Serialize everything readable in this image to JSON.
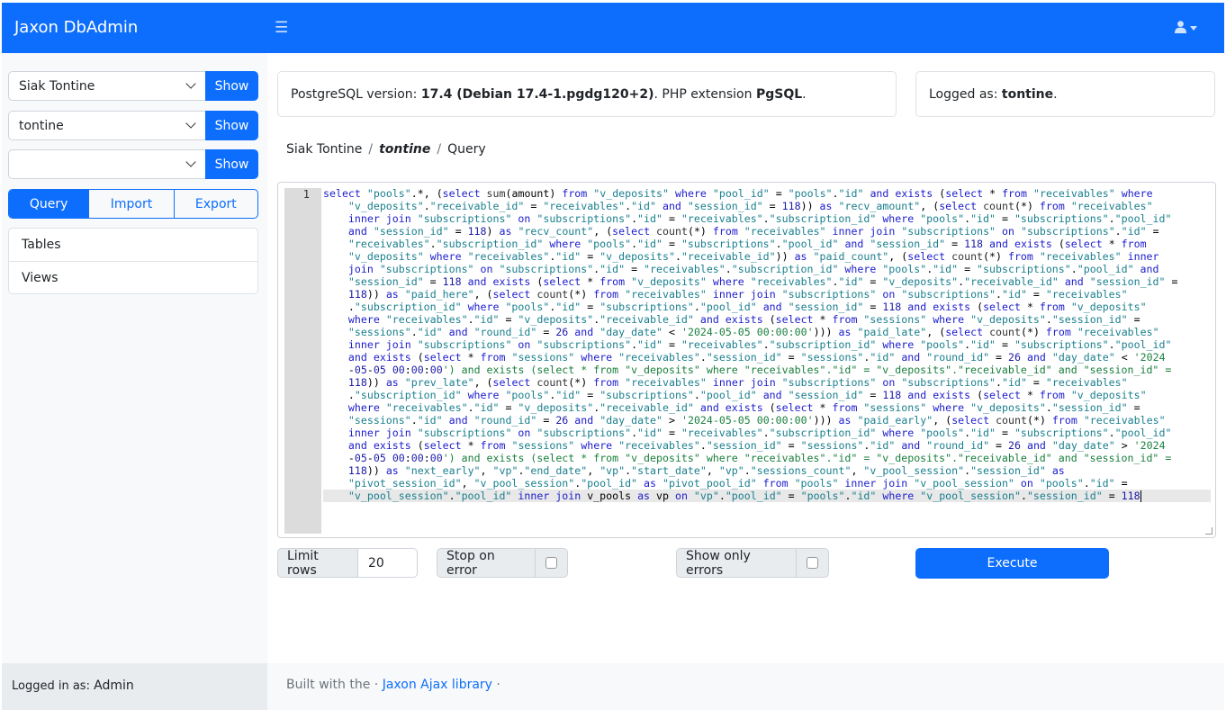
{
  "app": {
    "title": "Jaxon DbAdmin",
    "menu_icon": "hamburger-icon",
    "user_icon": "user-icon"
  },
  "sidebar": {
    "selects": [
      {
        "value": "Siak Tontine",
        "button": "Show"
      },
      {
        "value": "tontine",
        "button": "Show"
      },
      {
        "value": "",
        "button": "Show"
      }
    ],
    "tabs": [
      "Query",
      "Import",
      "Export"
    ],
    "active_tab": "Query",
    "items": [
      "Tables",
      "Views"
    ],
    "footer_label": "Logged in as:",
    "footer_user": "Admin"
  },
  "info": {
    "version_prefix": "PostgreSQL version: ",
    "version": "17.4 (Debian 17.4-1.pgdg120+2)",
    "ext_prefix": ". PHP extension ",
    "ext": "PgSQL",
    "ext_suffix": ".",
    "logged_prefix": "Logged as: ",
    "logged_user": "tontine",
    "logged_suffix": "."
  },
  "breadcrumb": {
    "server": "Siak Tontine",
    "sep": "/",
    "db": "tontine",
    "page": "Query"
  },
  "editor": {
    "line_number": "1",
    "lines": [
      "select \"pools\".*, (select sum(amount) from \"v_deposits\" where \"pool_id\" = \"pools\".\"id\" and exists (select * from \"receivables\" where",
      "    \"v_deposits\".\"receivable_id\" = \"receivables\".\"id\" and \"session_id\" = 118)) as \"recv_amount\", (select count(*) from \"receivables\"",
      "    inner join \"subscriptions\" on \"subscriptions\".\"id\" = \"receivables\".\"subscription_id\" where \"pools\".\"id\" = \"subscriptions\".\"pool_id\"",
      "    and \"session_id\" = 118) as \"recv_count\", (select count(*) from \"receivables\" inner join \"subscriptions\" on \"subscriptions\".\"id\" =",
      "    \"receivables\".\"subscription_id\" where \"pools\".\"id\" = \"subscriptions\".\"pool_id\" and \"session_id\" = 118 and exists (select * from",
      "    \"v_deposits\" where \"receivables\".\"id\" = \"v_deposits\".\"receivable_id\")) as \"paid_count\", (select count(*) from \"receivables\" inner",
      "    join \"subscriptions\" on \"subscriptions\".\"id\" = \"receivables\".\"subscription_id\" where \"pools\".\"id\" = \"subscriptions\".\"pool_id\" and",
      "    \"session_id\" = 118 and exists (select * from \"v_deposits\" where \"receivables\".\"id\" = \"v_deposits\".\"receivable_id\" and \"session_id\" =",
      "    118)) as \"paid_here\", (select count(*) from \"receivables\" inner join \"subscriptions\" on \"subscriptions\".\"id\" = \"receivables\"",
      "    .\"subscription_id\" where \"pools\".\"id\" = \"subscriptions\".\"pool_id\" and \"session_id\" = 118 and exists (select * from \"v_deposits\"",
      "    where \"receivables\".\"id\" = \"v_deposits\".\"receivable_id\" and exists (select * from \"sessions\" where \"v_deposits\".\"session_id\" =",
      "    \"sessions\".\"id\" and \"round_id\" = 26 and \"day_date\" < '2024-05-05 00:00:00'))) as \"paid_late\", (select count(*) from \"receivables\"",
      "    inner join \"subscriptions\" on \"subscriptions\".\"id\" = \"receivables\".\"subscription_id\" where \"pools\".\"id\" = \"subscriptions\".\"pool_id\"",
      "    and exists (select * from \"sessions\" where \"receivables\".\"session_id\" = \"sessions\".\"id\" and \"round_id\" = 26 and \"day_date\" < '2024",
      "    -05-05 00:00:00') and exists (select * from \"v_deposits\" where \"receivables\".\"id\" = \"v_deposits\".\"receivable_id\" and \"session_id\" =",
      "    118)) as \"prev_late\", (select count(*) from \"receivables\" inner join \"subscriptions\" on \"subscriptions\".\"id\" = \"receivables\"",
      "    .\"subscription_id\" where \"pools\".\"id\" = \"subscriptions\".\"pool_id\" and \"session_id\" = 118 and exists (select * from \"v_deposits\"",
      "    where \"receivables\".\"id\" = \"v_deposits\".\"receivable_id\" and exists (select * from \"sessions\" where \"v_deposits\".\"session_id\" =",
      "    \"sessions\".\"id\" and \"round_id\" = 26 and \"day_date\" > '2024-05-05 00:00:00'))) as \"paid_early\", (select count(*) from \"receivables\"",
      "    inner join \"subscriptions\" on \"subscriptions\".\"id\" = \"receivables\".\"subscription_id\" where \"pools\".\"id\" = \"subscriptions\".\"pool_id\"",
      "    and exists (select * from \"sessions\" where \"receivables\".\"session_id\" = \"sessions\".\"id\" and \"round_id\" = 26 and \"day_date\" > '2024",
      "    -05-05 00:00:00') and exists (select * from \"v_deposits\" where \"receivables\".\"id\" = \"v_deposits\".\"receivable_id\" and \"session_id\" =",
      "    118)) as \"next_early\", \"vp\".\"end_date\", \"vp\".\"start_date\", \"vp\".\"sessions_count\", \"v_pool_session\".\"session_id\" as",
      "    \"pivot_session_id\", \"v_pool_session\".\"pool_id\" as \"pivot_pool_id\" from \"pools\" inner join \"v_pool_session\" on \"pools\".\"id\" =",
      "    \"v_pool_session\".\"pool_id\" inner join v_pools as vp on \"vp\".\"pool_id\" = \"pools\".\"id\" where \"v_pool_session\".\"session_id\" = 118"
    ]
  },
  "controls": {
    "limit_label": "Limit rows",
    "limit_value": "20",
    "stop_label": "Stop on error",
    "errors_label": "Show only errors",
    "execute": "Execute"
  },
  "footer": {
    "prefix": "Built with the · ",
    "link": "Jaxon Ajax library",
    "suffix": " ·"
  }
}
